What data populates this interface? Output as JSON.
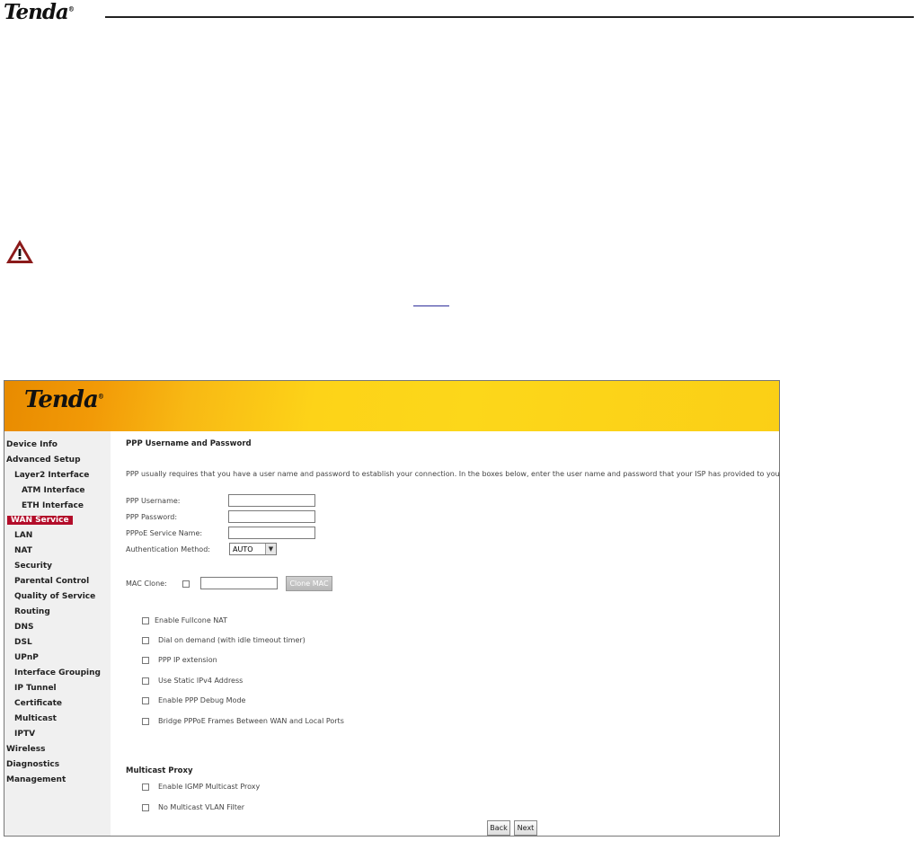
{
  "doc": {
    "logo": "Tenda",
    "logo_mark": "®"
  },
  "router": {
    "logo": "Tenda",
    "logo_mark": "®",
    "sidebar": [
      {
        "label": "Device Info",
        "active": false
      },
      {
        "label": "Advanced Setup",
        "active": false
      },
      {
        "label": "Layer2 Interface",
        "active": false
      },
      {
        "label": "ATM Interface",
        "active": false
      },
      {
        "label": "ETH Interface",
        "active": false
      },
      {
        "label": "WAN Service",
        "active": true
      },
      {
        "label": "LAN",
        "active": false
      },
      {
        "label": "NAT",
        "active": false
      },
      {
        "label": "Security",
        "active": false
      },
      {
        "label": "Parental Control",
        "active": false
      },
      {
        "label": "Quality of Service",
        "active": false
      },
      {
        "label": "Routing",
        "active": false
      },
      {
        "label": "DNS",
        "active": false
      },
      {
        "label": "DSL",
        "active": false
      },
      {
        "label": "UPnP",
        "active": false
      },
      {
        "label": "Interface Grouping",
        "active": false
      },
      {
        "label": "IP Tunnel",
        "active": false
      },
      {
        "label": "Certificate",
        "active": false
      },
      {
        "label": "Multicast",
        "active": false
      },
      {
        "label": "IPTV",
        "active": false
      },
      {
        "label": "Wireless",
        "active": false
      },
      {
        "label": "Diagnostics",
        "active": false
      },
      {
        "label": "Management",
        "active": false
      }
    ],
    "form": {
      "title": "PPP Username and Password",
      "description": "PPP usually requires that you have a user name and password to establish your connection. In the boxes below, enter the user name and password that your ISP has provided to you.",
      "username_label": "PPP Username:",
      "username_value": "",
      "password_label": "PPP Password:",
      "password_value": "",
      "service_label": "PPPoE Service Name:",
      "service_value": "",
      "auth_label": "Authentication Method:",
      "auth_value": "AUTO",
      "mac_clone_label": "MAC Clone:",
      "mac_clone_value": "",
      "clone_mac_button": "Clone MAC",
      "options": [
        "Enable Fullcone NAT",
        "Dial on demand (with idle timeout timer)",
        "PPP IP extension",
        "Use Static IPv4 Address",
        "Enable PPP Debug Mode",
        "Bridge PPPoE Frames Between WAN and Local Ports"
      ],
      "multicast_title": "Multicast Proxy",
      "multicast_options": [
        "Enable IGMP Multicast Proxy",
        "No Multicast VLAN Filter"
      ],
      "back_button": "Back",
      "next_button": "Next"
    }
  }
}
